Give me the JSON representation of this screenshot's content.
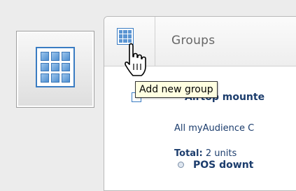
{
  "panel": {
    "title": "Groups",
    "add_group_tooltip": "Add new group"
  },
  "group": {
    "name": "Airtop mounte",
    "description": "All myAudience C",
    "total_label": "Total:",
    "total_value": "2 units",
    "units": [
      "POS downt"
    ]
  },
  "icons": {
    "side_button": "groups-grid-icon",
    "add_group": "add-group-grid-icon",
    "cursor": "hand-pointer-icon"
  },
  "colors": {
    "accent": "#3a7cc2",
    "text": "#1c3d6d",
    "tooltip_bg": "#ffffe1"
  }
}
